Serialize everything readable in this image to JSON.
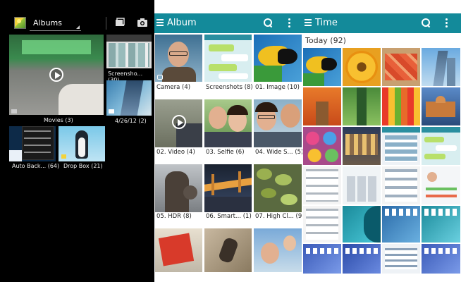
{
  "panel_albums": {
    "dropdown_label": "Albums",
    "albums": [
      {
        "id": "movies",
        "caption": "Movies (3)"
      },
      {
        "id": "screenshots",
        "caption": "Screensho... (30)"
      },
      {
        "id": "date",
        "caption": "4/26/12 (2)"
      },
      {
        "id": "auto-backup",
        "caption": "Auto Back... (64)"
      },
      {
        "id": "dropbox",
        "caption": "Drop Box (21)"
      }
    ],
    "icons": [
      "app-logo-icon",
      "new-album-icon",
      "camera-icon"
    ]
  },
  "panel_album": {
    "title": "Album",
    "items": [
      {
        "caption": "Camera  (4)"
      },
      {
        "caption": "Screenshots  (8)"
      },
      {
        "caption": "01. Image  (10)"
      },
      {
        "caption": "02. Video  (4)"
      },
      {
        "caption": "03. Selfie  (6)"
      },
      {
        "caption": "04. Wide S...  (5)"
      },
      {
        "caption": "05. HDR  (8)"
      },
      {
        "caption": "06. Smart...  (1)"
      },
      {
        "caption": "07. High Cl...  (9)"
      }
    ]
  },
  "panel_time": {
    "title": "Time",
    "section_header": "Today (92)"
  },
  "colors": {
    "accent": "#138a9a",
    "dark_bg": "#000000",
    "light_bg": "#ffffff"
  }
}
